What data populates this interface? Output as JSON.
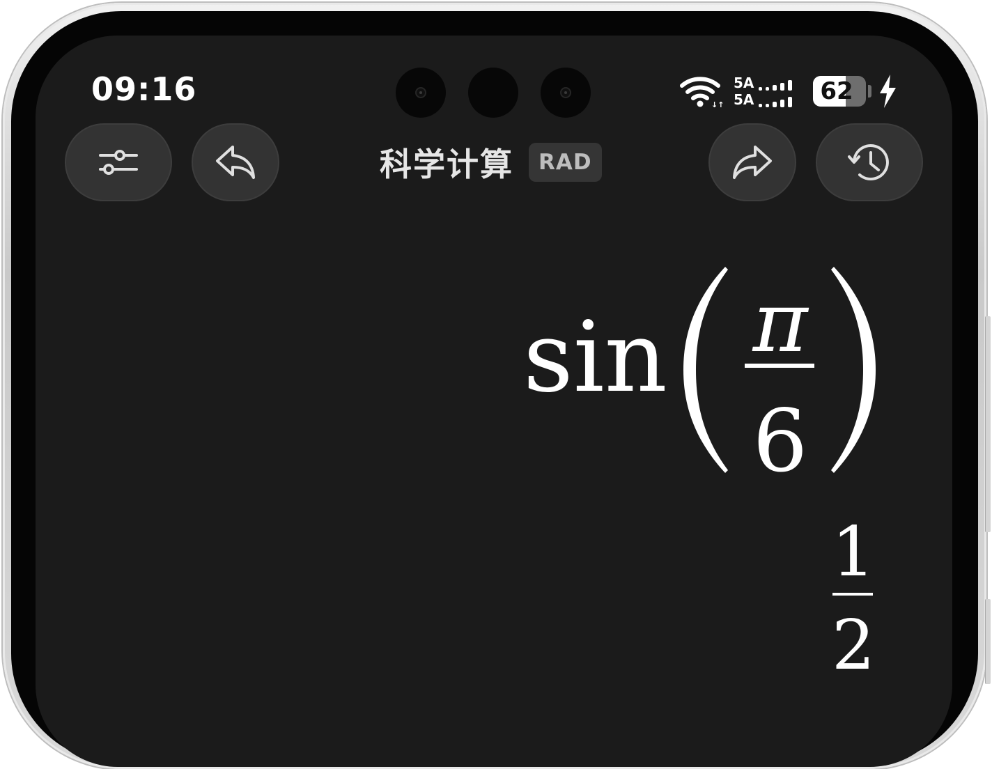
{
  "status_bar": {
    "time": "09:16",
    "network_1": "5A",
    "network_2": "5A",
    "battery_level": "62",
    "battery_fraction": 0.62,
    "charging": true,
    "icons": [
      "wifi-icon",
      "signal-icon",
      "battery-icon",
      "charging-icon"
    ]
  },
  "toolbar": {
    "title": "科学计算",
    "angle_mode": "RAD",
    "buttons": [
      "settings-sliders-icon",
      "undo-icon",
      "redo-icon",
      "history-clock-icon"
    ]
  },
  "display": {
    "function": "sin",
    "argument_numerator": "π",
    "argument_denominator": "6",
    "result_numerator": "1",
    "result_denominator": "2"
  },
  "colors": {
    "screen_background": "#1b1b1b",
    "button_background": "#333333",
    "text": "#ffffff",
    "badge_background": "#353535"
  }
}
